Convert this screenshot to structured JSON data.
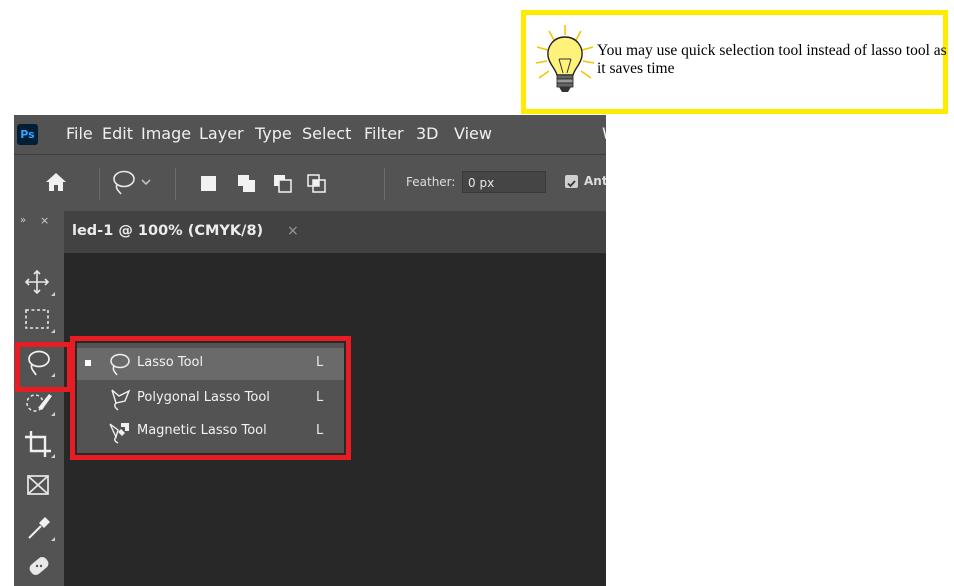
{
  "tip": {
    "text": "You may use quick selection tool instead of lasso tool as it saves time",
    "icon": "lightbulb-icon",
    "border_color": "#ffeb00"
  },
  "app": {
    "logo": "Ps",
    "menu": [
      "File",
      "Edit",
      "Image",
      "Layer",
      "Type",
      "Select",
      "Filter",
      "3D",
      "View",
      "W"
    ]
  },
  "options": {
    "feather_label": "Feather:",
    "feather_value": "0 px",
    "anti_alias_label": "Ant"
  },
  "toolbar": {
    "handle": "»",
    "close": "×",
    "tools": [
      "move-tool",
      "marquee-tool",
      "lasso-tool",
      "quick-selection-tool",
      "crop-tool",
      "frame-tool",
      "eyedropper-tool",
      "healing-brush-tool"
    ]
  },
  "document": {
    "tab_title": "led-1 @ 100% (CMYK/8)",
    "tab_close": "×"
  },
  "flyout": {
    "items": [
      {
        "label": "Lasso Tool",
        "key": "L",
        "selected": true,
        "icon": "lasso-icon"
      },
      {
        "label": "Polygonal Lasso Tool",
        "key": "L",
        "selected": false,
        "icon": "polygonal-lasso-icon"
      },
      {
        "label": "Magnetic Lasso Tool",
        "key": "L",
        "selected": false,
        "icon": "magnetic-lasso-icon"
      }
    ]
  },
  "highlight_color": "#e81c23"
}
